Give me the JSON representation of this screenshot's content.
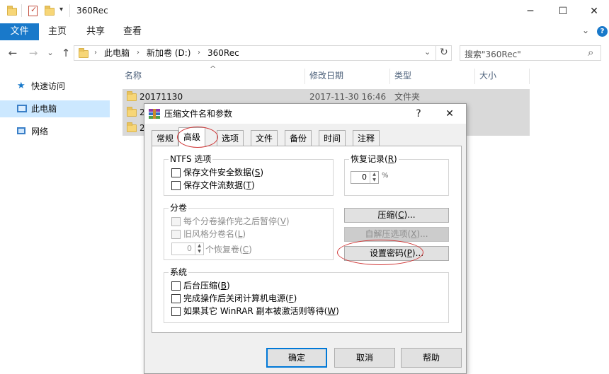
{
  "window": {
    "title": "360Rec",
    "title_icons": [
      "folder-icon",
      "properties-check-icon",
      "folder-icon",
      "dropdown-arrow-icon"
    ],
    "controls": {
      "minimize": "─",
      "maximize": "☐",
      "close": "✕"
    }
  },
  "ribbon": {
    "tabs": [
      "文件",
      "主页",
      "共享",
      "查看"
    ],
    "collapse": "⌄",
    "help": "?"
  },
  "address": {
    "back": "←",
    "forward": "→",
    "recent": "⌄",
    "up": "↑",
    "crumbs": [
      "此电脑",
      "新加卷 (D:)",
      "360Rec"
    ],
    "separator": "›",
    "dropdown": "⌄",
    "refresh": "↻",
    "search_placeholder": "搜索\"360Rec\"",
    "search_icon": "⌕"
  },
  "navpane": {
    "items": [
      {
        "label": "快速访问",
        "icon": "star-icon",
        "selected": false
      },
      {
        "label": "此电脑",
        "icon": "computer-icon",
        "selected": true
      },
      {
        "label": "网络",
        "icon": "network-icon",
        "selected": false
      }
    ]
  },
  "filelist": {
    "sort_indicator": "^",
    "columns": [
      "名称",
      "修改日期",
      "类型",
      "大小"
    ],
    "rows": [
      {
        "name": "20171130",
        "date": "2017-11-30 16:46",
        "type": "文件夹"
      },
      {
        "name": "2",
        "date": "",
        "type": ""
      },
      {
        "name": "2",
        "date": "",
        "type": ""
      }
    ]
  },
  "dialog": {
    "title": "压缩文件名和参数",
    "help": "?",
    "close": "✕",
    "tabs": [
      "常规",
      "高级",
      "选项",
      "文件",
      "备份",
      "时间",
      "注释"
    ],
    "active_tab": 1,
    "ntfs": {
      "label": "NTFS 选项",
      "items": [
        {
          "text": "保存文件安全数据",
          "key": "S"
        },
        {
          "text": "保存文件流数据",
          "key": "T"
        }
      ]
    },
    "recovery": {
      "label": "恢复记录",
      "key": "R",
      "value": "0",
      "unit": "%"
    },
    "volume": {
      "label": "分卷",
      "items": [
        {
          "text": "每个分卷操作完之后暂停",
          "key": "V"
        },
        {
          "text": "旧风格分卷名",
          "key": "L"
        }
      ],
      "spin_value": "0",
      "spin_label": "个恢复卷",
      "spin_key": "C"
    },
    "buttons": [
      {
        "text": "压缩",
        "key": "C",
        "suffix": "...",
        "disabled": false
      },
      {
        "text": "自解压选项",
        "key": "X",
        "suffix": "...",
        "disabled": true
      },
      {
        "text": "设置密码",
        "key": "P",
        "suffix": "...",
        "disabled": false
      }
    ],
    "system": {
      "label": "系统",
      "items": [
        {
          "text": "后台压缩",
          "key": "B"
        },
        {
          "text": "完成操作后关闭计算机电源",
          "key": "F"
        },
        {
          "text": "如果其它 WinRAR 副本被激活则等待",
          "key": "W"
        }
      ]
    },
    "footer": {
      "ok": "确定",
      "cancel": "取消",
      "help": "帮助"
    },
    "annotation_color": "#d03a3a"
  }
}
